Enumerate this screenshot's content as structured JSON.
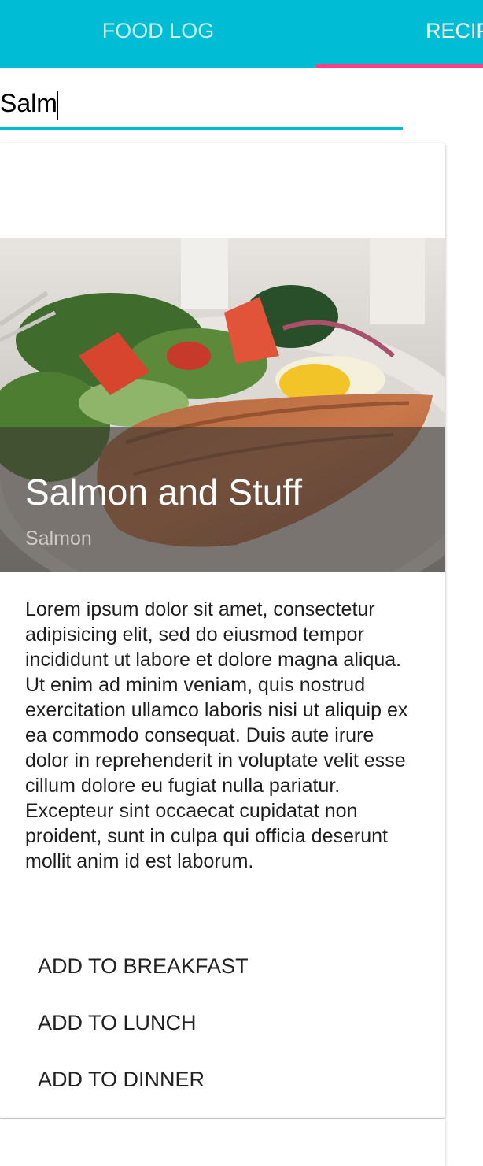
{
  "tabs": [
    {
      "label": "FOOD LOG"
    },
    {
      "label": "RECIPES"
    }
  ],
  "search": {
    "value": "Salm"
  },
  "recipe": {
    "title": "Salmon and Stuff",
    "subtitle": "Salmon",
    "description": "Lorem ipsum dolor sit amet, consectetur adipisicing elit, sed do eiusmod tempor incididunt ut labore et dolore magna aliqua. Ut enim ad minim veniam, quis nostrud exercitation ullamco laboris nisi ut aliquip ex ea commodo consequat. Duis aute irure dolor in reprehenderit in voluptate velit esse cillum dolore eu fugiat nulla pariatur. Excepteur sint occaecat cupidatat non proident, sunt in culpa qui officia deserunt mollit anim id est laborum.",
    "actions": [
      {
        "label": "ADD TO BREAKFAST"
      },
      {
        "label": "ADD TO LUNCH"
      },
      {
        "label": "ADD TO DINNER"
      }
    ]
  },
  "colors": {
    "primary": "#00bcd4",
    "accent": "#ff4081"
  }
}
